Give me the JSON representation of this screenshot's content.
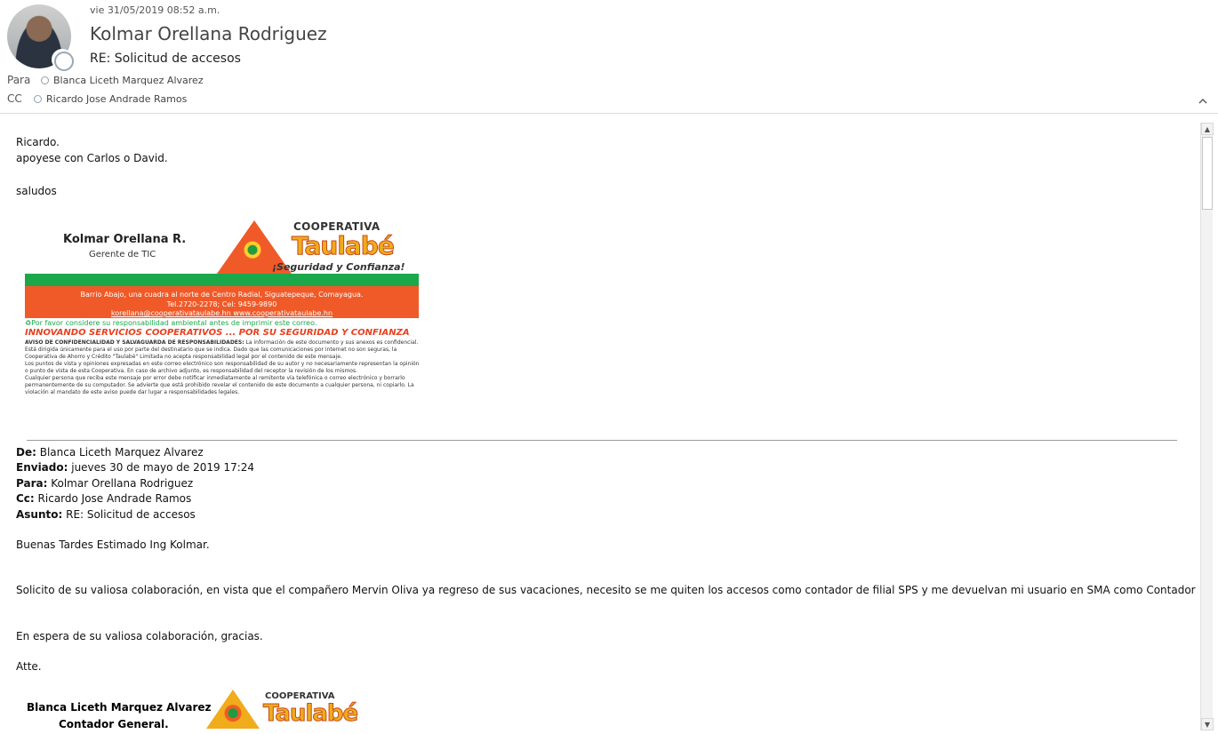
{
  "header": {
    "date": "vie 31/05/2019 08:52 a.m.",
    "sender": "Kolmar Orellana Rodriguez",
    "subject": "RE: Solicitud de accesos",
    "to_label": "Para",
    "to": "Blanca Liceth Marquez Alvarez",
    "cc_label": "CC",
    "cc": "Ricardo Jose Andrade Ramos"
  },
  "message": {
    "line1": "Ricardo.",
    "line2": "apoyese con Carlos o David.",
    "line3": "saludos"
  },
  "signature": {
    "name": "Kolmar Orellana R.",
    "role": "Gerente de TIC",
    "brand_top": "COOPERATIVA",
    "brand": "Taulabé",
    "slogan": "¡Seguridad y Confianza!",
    "address": "Barrio Abajo, una cuadra al norte de Centro Radial, Siguatepeque, Comayagua.",
    "phones": "Tel.2720-2278; Cel: 9459-9890",
    "contact": "korellana@cooperativataulabe.hn www.cooperativataulabe.hn",
    "env_note": "Por favor considere su responsabilidad ambiental antes de imprimir este correo.",
    "innovate": "INNOVANDO SERVICIOS COOPERATIVOS ... POR SU SEGURIDAD Y CONFIANZA",
    "legal_title": "AVISO DE CONFIDENCIALIDAD Y SALVAGUARDA DE RESPONSABILIDADES:",
    "legal_p1": "La información de este documento y sus anexos es confidencial. Está dirigida únicamente para el uso por parte del destinatario que se indica. Dado que las comunicaciones por internet no son seguras, la Cooperativa de Ahorro y Crédito \"Taulabé\" Limitada no acepta responsabilidad legal por el contenido de este mensaje.",
    "legal_p2": "Los puntos de vista y opiniones expresadas en este correo electrónico son responsabilidad de su autor y no necesariamente representan la opinión o punto de vista de esta Cooperativa. En caso de archivo adjunto, es responsabilidad del receptor la revisión de los mismos.",
    "legal_p3": "Cualquier persona que reciba este mensaje por error debe notificar inmediatamente al remitente vía telefónica o correo electrónico y borrarlo permanentemente de su computador. Se advierte que está prohibido revelar el contenido de este documento a cualquier persona, ni copiarlo. La violación al mandato de este aviso puede dar lugar a responsabilidades legales."
  },
  "forwarded": {
    "from_label": "De:",
    "from": "Blanca Liceth Marquez Alvarez",
    "sent_label": "Enviado:",
    "sent": "jueves 30 de mayo de 2019 17:24",
    "to_label": "Para:",
    "to": "Kolmar Orellana Rodriguez",
    "cc_label": "Cc:",
    "cc": "Ricardo Jose Andrade Ramos",
    "subject_label": "Asunto:",
    "subject": "RE: Solicitud de accesos",
    "greeting": "Buenas Tardes Estimado Ing Kolmar.",
    "body": "Solicito de su valiosa colaboración, en vista que el compañero  Mervin Oliva ya regreso de sus vacaciones,  necesito se me quiten los accesos como contador de filial SPS  y me devuelvan mi usuario en SMA como Contador General.",
    "closing": "En espera de su valiosa colaboración, gracias.",
    "atte": "Atte.",
    "sig_name": "Blanca Liceth Marquez Alvarez",
    "sig_role": "Contador General.",
    "brand_top": "COOPERATIVA",
    "brand": "Taulabé"
  }
}
